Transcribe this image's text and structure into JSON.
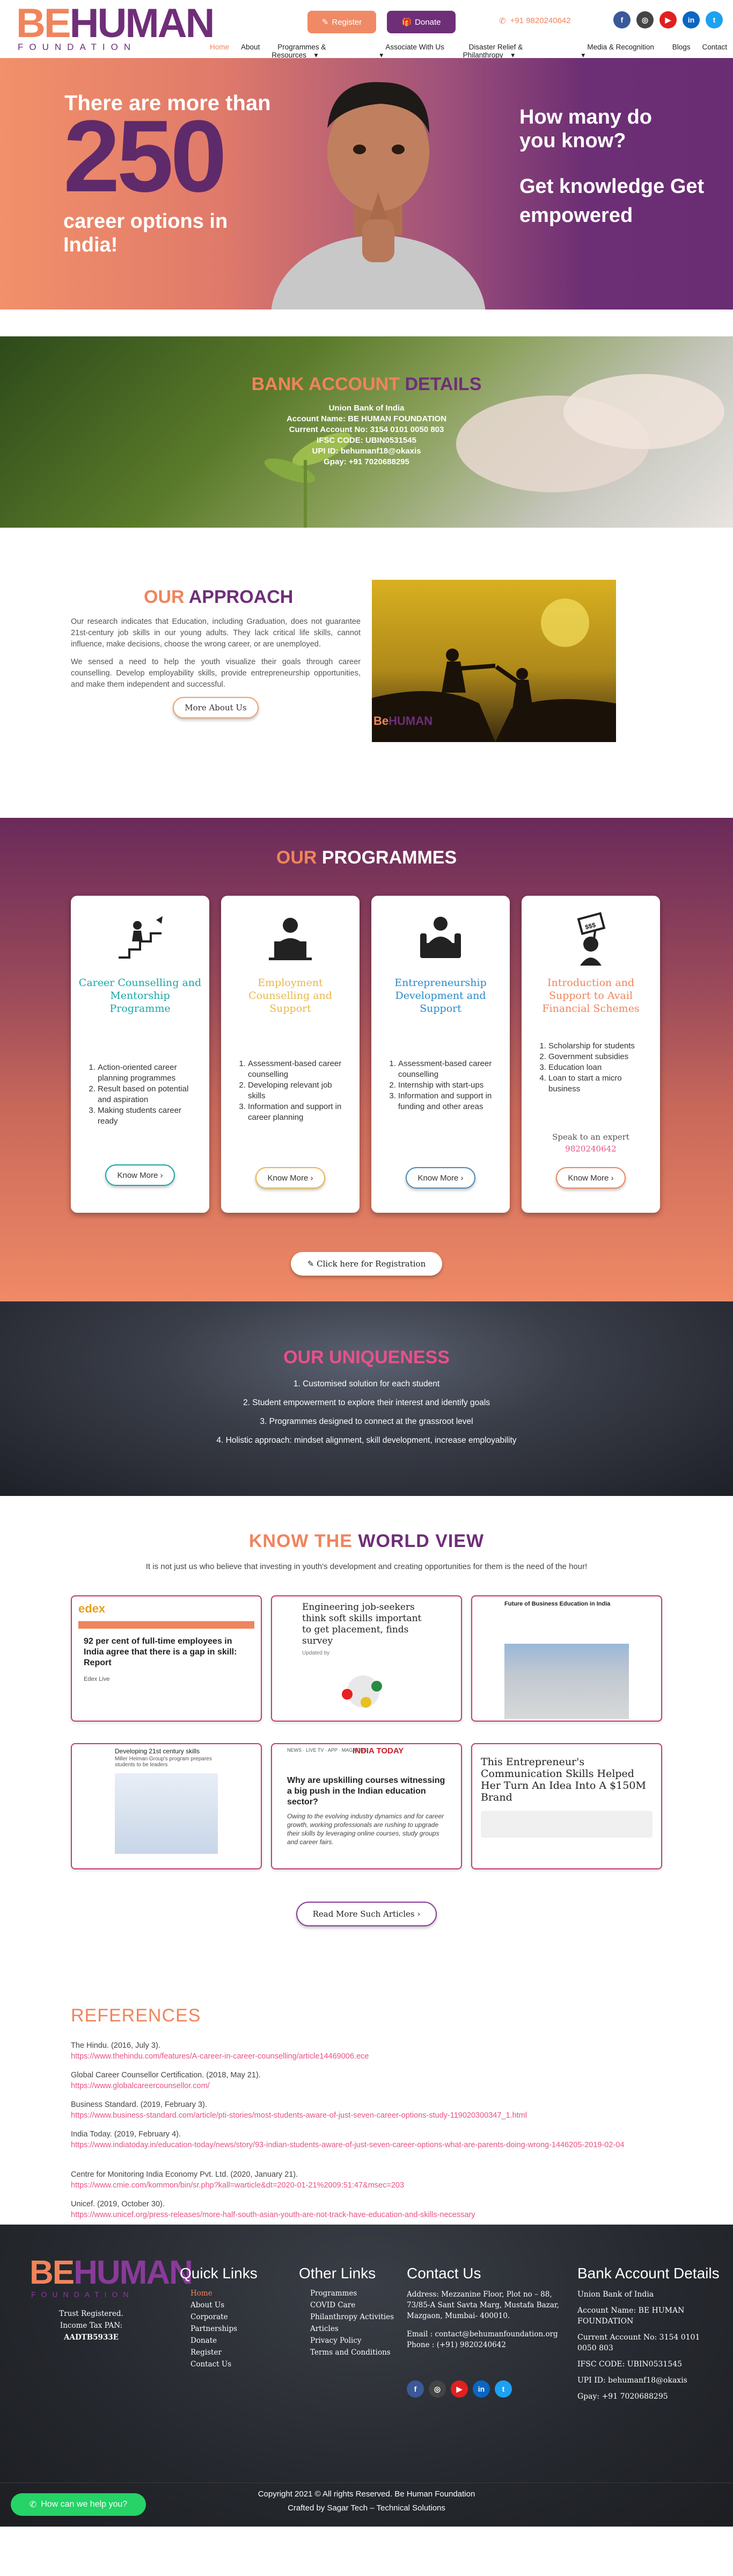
{
  "header": {
    "logo_be": "BE",
    "logo_human": "HUMAN",
    "logo_sub": "FOUNDATION",
    "register_label": "Register",
    "donate_label": "Donate",
    "phone": "+91 9820240642",
    "nav": [
      "Home",
      "About",
      "Programmes & Resources",
      "Associate With Us",
      "Disaster Relief & Philanthropy",
      "Media & Recognition",
      "Blogs",
      "Contact"
    ],
    "colors": {
      "orange": "#f0845c",
      "purple": "#6f2e78"
    }
  },
  "hero": {
    "line1": "There are more than",
    "number": "250",
    "line3": "career options in India!",
    "right1": "How many do you know?",
    "right2": "Get knowledge Get empowered"
  },
  "bank": {
    "title_a": "BANK ACCOUNT",
    "title_b": "DETAILS",
    "lines": [
      "Union Bank of India",
      "Account Name: BE HUMAN FOUNDATION",
      "Current Account No: 3154 0101 0050 803",
      "IFSC CODE: UBIN0531545",
      "UPI ID: behumanf18@okaxis",
      "Gpay: +91 7020688295"
    ]
  },
  "approach": {
    "title_a": "OUR",
    "title_b": "APPROACH",
    "p1": "Our research indicates that Education, including Graduation, does not guarantee 21st-century job skills in our young adults. They lack critical life skills, cannot influence, make decisions, choose the wrong career, or are unemployed.",
    "p2": "We sensed a need to help the youth visualize their goals through career counselling. Develop employability skills, provide entrepreneurship opportunities, and make them independent and successful.",
    "button": "More About Us",
    "image_caption": "BeHUMAN"
  },
  "programmes": {
    "title_a": "OUR",
    "title_b": "PROGRAMMES",
    "cards": [
      {
        "title": "Career Counselling and Mentorship Programme",
        "color": "#1aa6a6",
        "items": [
          "Action-oriented career planning programmes",
          "Result based on potential and aspiration",
          "Making students career ready"
        ],
        "button": "Know More",
        "btn_color": "#1aa6a6"
      },
      {
        "title": "Employment Counselling and Support",
        "color": "#e8b84a",
        "items": [
          "Assessment-based career counselling",
          "Developing relevant job skills",
          "Information and support in career planning"
        ],
        "button": "Know More",
        "btn_color": "#e8b84a"
      },
      {
        "title": "Entrepreneurship Development and Support",
        "color": "#2a8ac8",
        "items": [
          "Assessment-based career counselling",
          "Internship with start-ups",
          "Information and support in funding and other areas"
        ],
        "button": "Know More",
        "btn_color": "#4a8ab8"
      },
      {
        "title": "Introduction and Support to Avail Financial Schemes",
        "color": "#f0845c",
        "items": [
          "Scholarship for students",
          "Government subsidies",
          "Education loan",
          "Loan to start a micro business"
        ],
        "speak": "Speak to an expert",
        "speak_phone": "9820240642",
        "button": "Know More",
        "btn_color": "#f0845c"
      }
    ],
    "register_button": "Click here for Registration"
  },
  "uniqueness": {
    "title_a": "OUR",
    "title_b": "UNIQUENESS",
    "items": [
      "1. Customised solution for each student",
      "2. Student empowerment to explore their interest and identify goals",
      "3. Programmes designed to connect at the grassroot level",
      "4. Holistic approach: mindset alignment, skill development, increase employability"
    ]
  },
  "world": {
    "title_a": "KNOW THE",
    "title_b": "WORLD VIEW",
    "subtitle": "It is not just us who believe that investing in youth's development and creating opportunities for them is the need of the hour!",
    "articles": [
      {
        "brand": "edex",
        "headline": "92 per cent of full-time employees in India agree that there is a gap in skill: Report",
        "author": "Edex Live"
      },
      {
        "headline": "Engineering job-seekers think soft skills important to get placement, finds survey",
        "author": "Updated by"
      },
      {
        "headline": "Future of Business Education in India"
      },
      {
        "headline": "Developing 21st century skills",
        "sub": "Miller Heiman Group's program prepares students to be leaders"
      },
      {
        "brand": "INDIA TODAY",
        "top": "NEWS · LIVE TV · APP · MAGAZINE",
        "headline": "Why are upskilling courses witnessing a big push in the Indian education sector?",
        "desc": "Owing to the evolving industry dynamics and for career growth, working professionals are rushing to upgrade their skills by leveraging online courses, study groups and career fairs."
      },
      {
        "headline": "This Entrepreneur's Communication Skills Helped Her Turn An Idea Into A $150M Brand"
      }
    ],
    "button": "Read More Such Articles"
  },
  "references": {
    "title": "REFERENCES",
    "items": [
      {
        "text": "The Hindu. (2016, July 3).",
        "url": "https://www.thehindu.com/features/A-career-in-career-counselling/article14469006.ece"
      },
      {
        "text": "Global Career Counsellor Certification. (2018, May 21).",
        "url": "https://www.globalcareercounsellor.com/"
      },
      {
        "text": "Business Standard. (2019, February 3).",
        "url": "https://www.business-standard.com/article/pti-stories/most-students-aware-of-just-seven-career-options-study-119020300347_1.html"
      },
      {
        "text": "India Today. (2019, February 4).",
        "url": "https://www.indiatoday.in/education-today/news/story/93-indian-students-aware-of-just-seven-career-options-what-are-parents-doing-wrong-1446205-2019-02-04"
      },
      {
        "text": "Centre for Monitoring India Economy Pvt. Ltd. (2020, January 21).",
        "url": "https://www.cmie.com/kommon/bin/sr.php?kall=warticle&dt=2020-01-21%2009:51:47&msec=203"
      },
      {
        "text": "Unicef. (2019, October 30).",
        "url": "https://www.unicef.org/press-releases/more-half-south-asian-youth-are-not-track-have-education-and-skills-necessary"
      }
    ]
  },
  "footer": {
    "trust": [
      "Trust Registered.",
      "Income Tax PAN:",
      "AADTB5933E"
    ],
    "quick_title": "Quick Links",
    "quick": [
      "Home",
      "About Us",
      "Corporate",
      "Partnerships",
      "Donate",
      "Register",
      "Contact Us"
    ],
    "other_title": "Other Links",
    "other": [
      "Programmes",
      "COVID Care",
      "Philanthropy Activities",
      "Articles",
      "Privacy Policy",
      "Terms and Conditions"
    ],
    "contact_title": "Contact Us",
    "address": "Address: Mezzanine Floor, Plot no – 88, 73/85-A Sant Savta Marg, Mustafa Bazar, Mazgaon, Mumbai- 400010.",
    "email": "Email : contact@behumanfoundation.org",
    "phone": "Phone : (+91) 9820240642",
    "bank_title": "Bank Account Details",
    "bank": [
      "Union Bank of India",
      "Account Name: BE HUMAN FOUNDATION",
      "Current Account No: 3154 0101 0050 803",
      "IFSC CODE: UBIN0531545",
      "UPI ID: behumanf18@okaxis",
      "Gpay: +91 7020688295"
    ],
    "copyright": "Copyright 2021 © All rights Reserved. Be Human Foundation",
    "credit": "Crafted by Sagar Tech – Technical Solutions",
    "whatsapp": "How can we help you?"
  }
}
